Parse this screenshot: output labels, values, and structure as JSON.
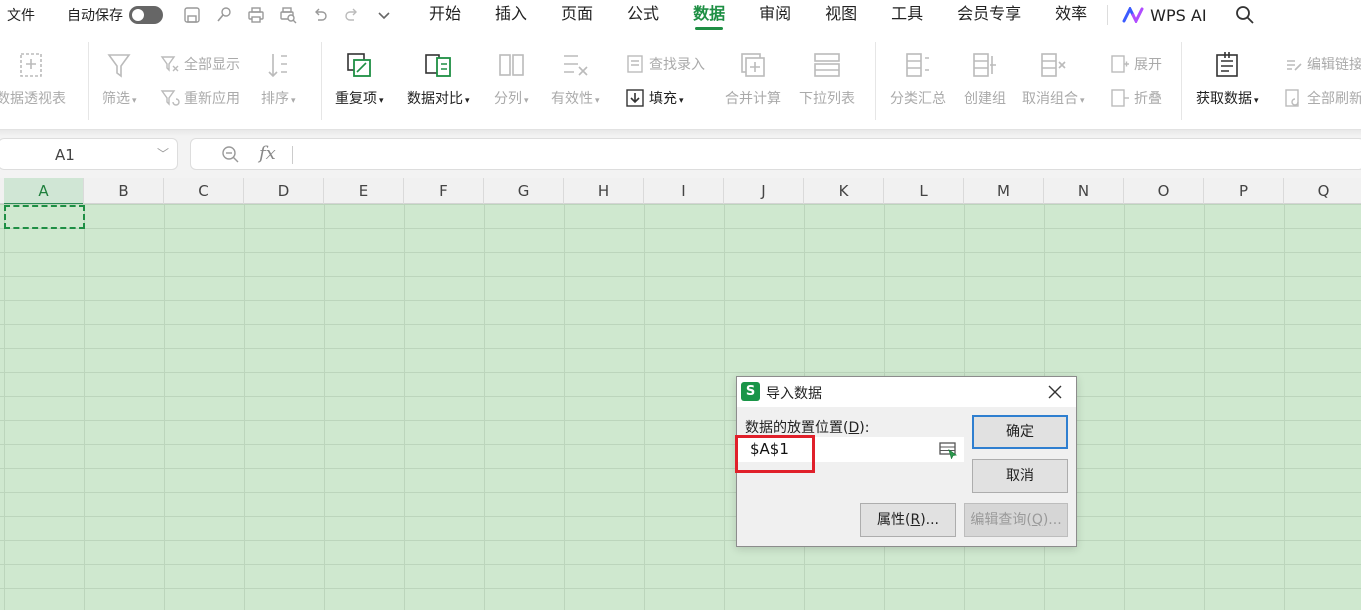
{
  "menubar": {
    "file": "文件",
    "autosave": "自动保存",
    "tabs": [
      "开始",
      "插入",
      "页面",
      "公式",
      "数据",
      "审阅",
      "视图",
      "工具",
      "会员专享",
      "效率"
    ],
    "active_tab": "数据",
    "wps_ai": "WPS AI",
    "quick_icons": [
      "save-icon",
      "share-icon",
      "print-icon",
      "print-preview-icon",
      "undo-icon",
      "redo-icon",
      "more-icon"
    ]
  },
  "ribbon": {
    "pivot": "数据透视表",
    "filter": "筛选",
    "show_all": "全部显示",
    "reapply": "重新应用",
    "sort": "排序",
    "duplicates": "重复项",
    "compare": "数据对比",
    "split": "分列",
    "validity": "有效性",
    "lookup_entry": "查找录入",
    "fill": "填充",
    "consolidate": "合并计算",
    "dropdown_list": "下拉列表",
    "subtotal": "分类汇总",
    "create_group": "创建组",
    "ungroup": "取消组合",
    "expand": "展开",
    "collapse": "折叠",
    "get_data": "获取数据",
    "edit_links": "编辑链接",
    "refresh_all": "全部刷新"
  },
  "formula_bar": {
    "name_box": "A1",
    "fx": "fx",
    "formula": ""
  },
  "columns": [
    "A",
    "B",
    "C",
    "D",
    "E",
    "F",
    "G",
    "H",
    "I",
    "J",
    "K",
    "L",
    "M",
    "N",
    "O",
    "P",
    "Q"
  ],
  "selected_column": "A",
  "dialog": {
    "title": "导入数据",
    "logo": "S",
    "label_prefix": "数据的放置位置(",
    "label_key": "D",
    "label_suffix": "):",
    "location_value": "$A$1",
    "ok": "确定",
    "cancel": "取消",
    "properties_prefix": "属性(",
    "properties_key": "R",
    "properties_suffix": ")...",
    "edit_query_prefix": "编辑查询(",
    "edit_query_key": "Q",
    "edit_query_suffix": ")..."
  },
  "colors": {
    "accent": "#1e8f44",
    "sheet_bg": "#cfe8cf",
    "highlight": "#e0202a",
    "primary_button_border": "#2f7fd0"
  }
}
